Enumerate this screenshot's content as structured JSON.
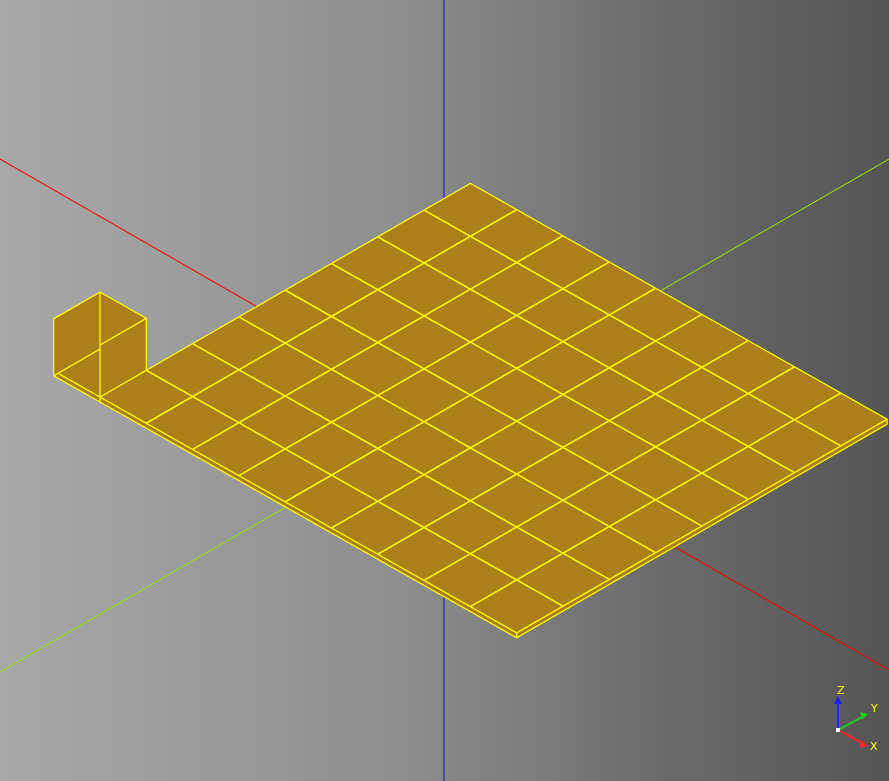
{
  "viewer": {
    "background_colors": [
      "#a8a8a8",
      "#555555"
    ],
    "model_fill": "#ad7f18",
    "edge_color": "#ffff00",
    "axis_colors": {
      "x": "#ff0000",
      "y": "#88cc00",
      "z": "#0000bb"
    }
  },
  "model": {
    "description_items": {
      "plate_grid_cells": "10 x 8",
      "cube_units": 1
    }
  },
  "triad": {
    "z_label": "Z",
    "y_label": "Y",
    "x_label": "X",
    "colors": {
      "z": "#0000ff",
      "y": "#00cc00",
      "x": "#ff0000",
      "label": "#ffff00"
    }
  }
}
